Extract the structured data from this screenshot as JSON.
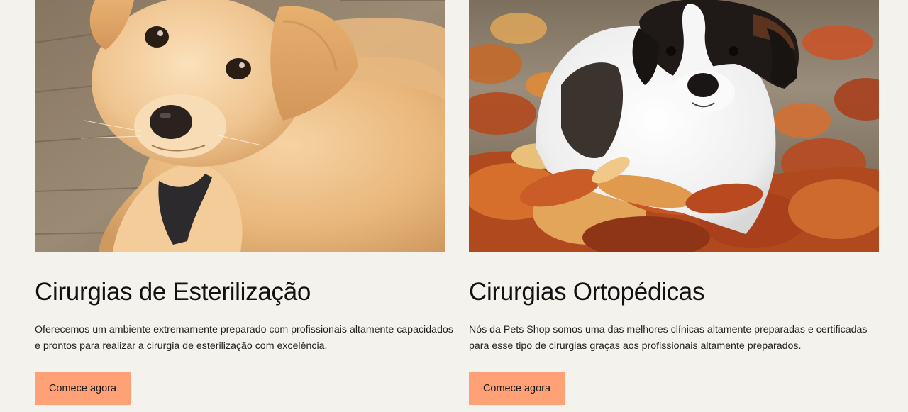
{
  "cards": [
    {
      "image_subject": "golden-puppy",
      "title": "Cirurgias de Esterilização",
      "description": "Oferecemos um ambiente extremamente preparado com profissionais altamente capacidados e prontos para realizar a cirurgia de esterilização com excelência.",
      "button_label": "Comece agora"
    },
    {
      "image_subject": "saint-bernard-puppy-in-leaves",
      "title": "Cirurgias Ortopédicas",
      "description": "Nós da Pets Shop somos uma das melhores clínicas altamente preparadas e certificadas para esse tipo de cirurgias graças aos profissionais altamente preparados.",
      "button_label": "Comece agora"
    }
  ],
  "colors": {
    "background": "#f4f2ec",
    "button": "#ffa176",
    "text": "#151515"
  }
}
